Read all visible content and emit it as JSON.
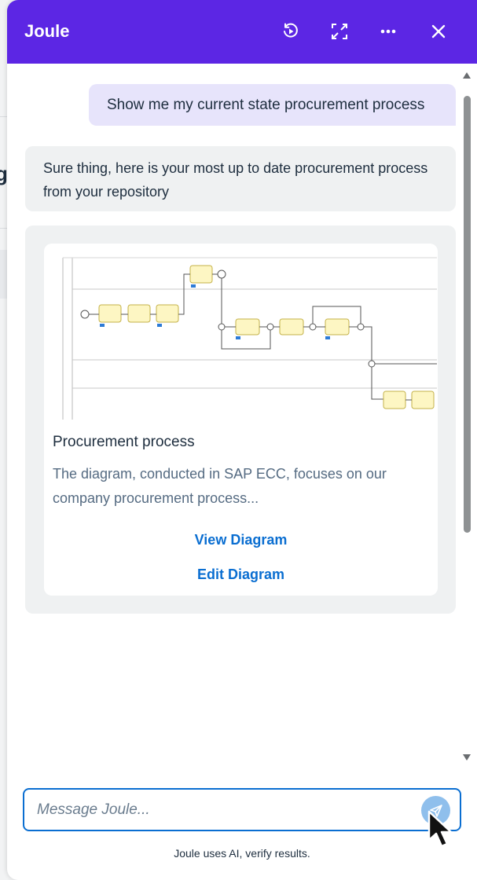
{
  "panel": {
    "title": "Joule",
    "header_icons": [
      "history-icon",
      "expand-icon",
      "more-icon",
      "close-icon"
    ]
  },
  "conversation": {
    "user_message": "Show me my current state procurement process",
    "bot_message": "Sure thing, here is your most up to date procurement process from your repository",
    "card": {
      "title": "Procurement process",
      "description": "The diagram, conducted in SAP ECC, focuses on our company procurement process...",
      "view_label": "View Diagram",
      "edit_label": "Edit Diagram"
    }
  },
  "composer": {
    "placeholder": "Message Joule...",
    "value": ""
  },
  "footer": {
    "note": "Joule uses AI, verify results."
  },
  "colors": {
    "header": "#5c26e4",
    "user_bubble": "#e7e4fb",
    "bot_bubble": "#eff1f2",
    "link": "#0a6ed1",
    "input_border": "#0a6ed1",
    "send_button": "#8fbfec"
  }
}
